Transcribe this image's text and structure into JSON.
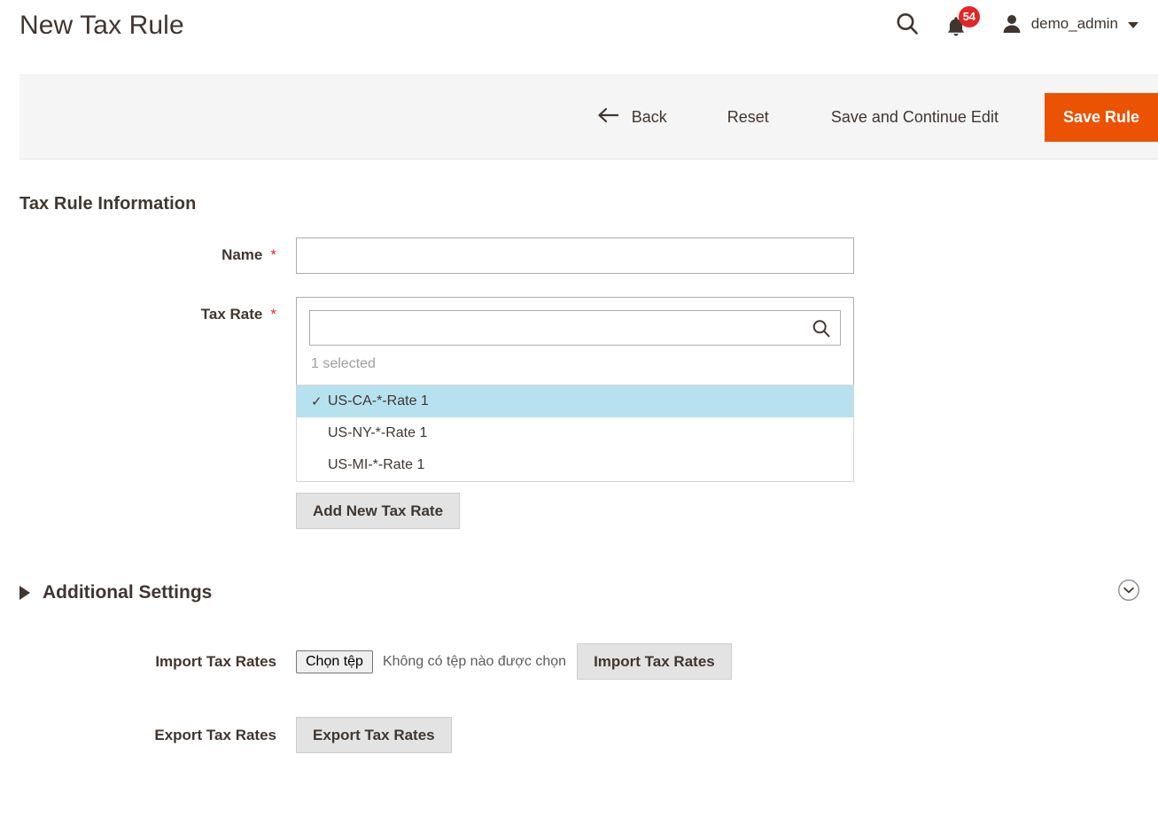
{
  "header": {
    "title": "New Tax Rule",
    "search_icon": "search-icon",
    "bell_icon": "notification-bell-icon",
    "notification_count": "54",
    "avatar_icon": "user-avatar-icon",
    "admin_name": "demo_admin",
    "caret_icon": "chevron-down-icon"
  },
  "toolbar": {
    "back_label": "Back",
    "back_icon": "arrow-left-icon",
    "reset_label": "Reset",
    "save_continue_label": "Save and Continue Edit",
    "save_label": "Save Rule",
    "primary_color": "#eb5202",
    "background_color": "#f5f5f5"
  },
  "section": {
    "title": "Tax Rule Information"
  },
  "name_field": {
    "label": "Name",
    "required_mark": "*",
    "value": "",
    "placeholder": ""
  },
  "tax_rate_field": {
    "label": "Tax Rate",
    "required_mark": "*",
    "search_value": "",
    "search_placeholder": "",
    "search_icon": "search-icon",
    "selected_summary": "1 selected",
    "options": [
      {
        "label": "US-CA-*-Rate 1",
        "selected": true,
        "check": "✓"
      },
      {
        "label": "US-NY-*-Rate 1",
        "selected": false,
        "check": "✓"
      },
      {
        "label": "US-MI-*-Rate 1",
        "selected": false,
        "check": "✓"
      }
    ],
    "selected_highlight_color": "#b6e2f0",
    "add_button_label": "Add New Tax Rate"
  },
  "additional_settings": {
    "title": "Additional Settings",
    "expander_icon": "triangle-right-icon",
    "collapse_icon": "circle-chevron-down-icon",
    "import": {
      "label": "Import Tax Rates",
      "file_button_label": "Chọn tệp",
      "file_status_text": "Không có tệp nào được chọn",
      "action_button_label": "Import Tax Rates"
    },
    "export": {
      "label": "Export Tax Rates",
      "action_button_label": "Export Tax Rates"
    }
  }
}
